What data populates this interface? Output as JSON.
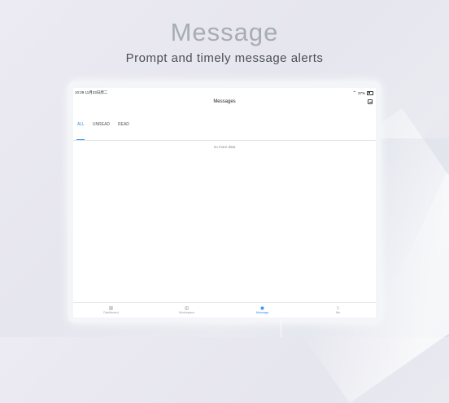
{
  "hero": {
    "title": "Message",
    "subtitle": "Prompt and timely message alerts"
  },
  "status_bar": {
    "time": "10:29",
    "date": "11月23日周二",
    "battery": "37%"
  },
  "nav": {
    "title": "Messages",
    "scan_icon": "scan-icon"
  },
  "tabs": [
    {
      "label": "ALL",
      "active": true
    },
    {
      "label": "UNREAD",
      "active": false
    },
    {
      "label": "READ",
      "active": false
    }
  ],
  "list": {
    "empty_text": "no more data"
  },
  "tabbar": [
    {
      "label": "Dashboard",
      "icon": "grid-icon",
      "active": false
    },
    {
      "label": "Workspace",
      "icon": "workspace-icon",
      "active": false
    },
    {
      "label": "Message",
      "icon": "chat-icon",
      "active": true
    },
    {
      "label": "Me",
      "icon": "person-icon",
      "active": false
    }
  ],
  "colors": {
    "accent": "#2c8ff5",
    "headline": "#a7acb7"
  }
}
